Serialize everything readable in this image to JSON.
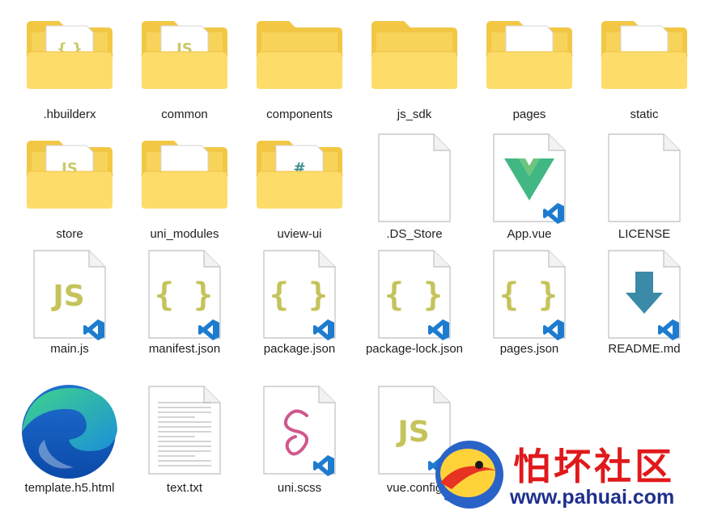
{
  "items": [
    {
      "name": ".hbuilderx",
      "kind": "folder",
      "preview": "{ }",
      "preview_color": "#c9c86a"
    },
    {
      "name": "common",
      "kind": "folder",
      "preview": "JS",
      "preview_color": "#c9c86a"
    },
    {
      "name": "components",
      "kind": "folder",
      "preview": "",
      "preview_color": ""
    },
    {
      "name": "js_sdk",
      "kind": "folder",
      "preview": "",
      "preview_color": ""
    },
    {
      "name": "pages",
      "kind": "folder",
      "preview": "doc",
      "preview_color": ""
    },
    {
      "name": "static",
      "kind": "folder",
      "preview": "doc",
      "preview_color": ""
    },
    {
      "name": "store",
      "kind": "folder",
      "preview": "JS",
      "preview_color": "#c9c86a"
    },
    {
      "name": "uni_modules",
      "kind": "folder",
      "preview": "doc",
      "preview_color": ""
    },
    {
      "name": "uview-ui",
      "kind": "folder",
      "preview": "#",
      "preview_color": "#3b8c8c"
    },
    {
      "name": ".DS_Store",
      "kind": "blank-file"
    },
    {
      "name": "App.vue",
      "kind": "vue-file"
    },
    {
      "name": "LICENSE",
      "kind": "blank-file"
    },
    {
      "name": "main.js",
      "kind": "code-file",
      "glyph": "JS"
    },
    {
      "name": "manifest.json",
      "kind": "code-file",
      "glyph": "{ }"
    },
    {
      "name": "package.json",
      "kind": "code-file",
      "glyph": "{ }"
    },
    {
      "name": "package-lock.json",
      "kind": "code-file",
      "glyph": "{ }"
    },
    {
      "name": "pages.json",
      "kind": "code-file",
      "glyph": "{ }"
    },
    {
      "name": "README.md",
      "kind": "md-file"
    },
    {
      "name": "template.h5.html",
      "kind": "edge-file"
    },
    {
      "name": "text.txt",
      "kind": "txt-file"
    },
    {
      "name": "uni.scss",
      "kind": "scss-file"
    },
    {
      "name": "vue.config",
      "kind": "code-file",
      "glyph": "JS"
    }
  ],
  "watermark": {
    "cn": "怕坏社区",
    "url": "www.pahuai.com"
  },
  "colors": {
    "folder_back": "#f2c744",
    "folder_front": "#fddc6a",
    "code_glyph": "#c5c35a",
    "vscode_badge": "#1e7ccf",
    "vue_green": "#41b883",
    "vue_dark": "#35495e",
    "md_arrow": "#3a8aa8"
  }
}
